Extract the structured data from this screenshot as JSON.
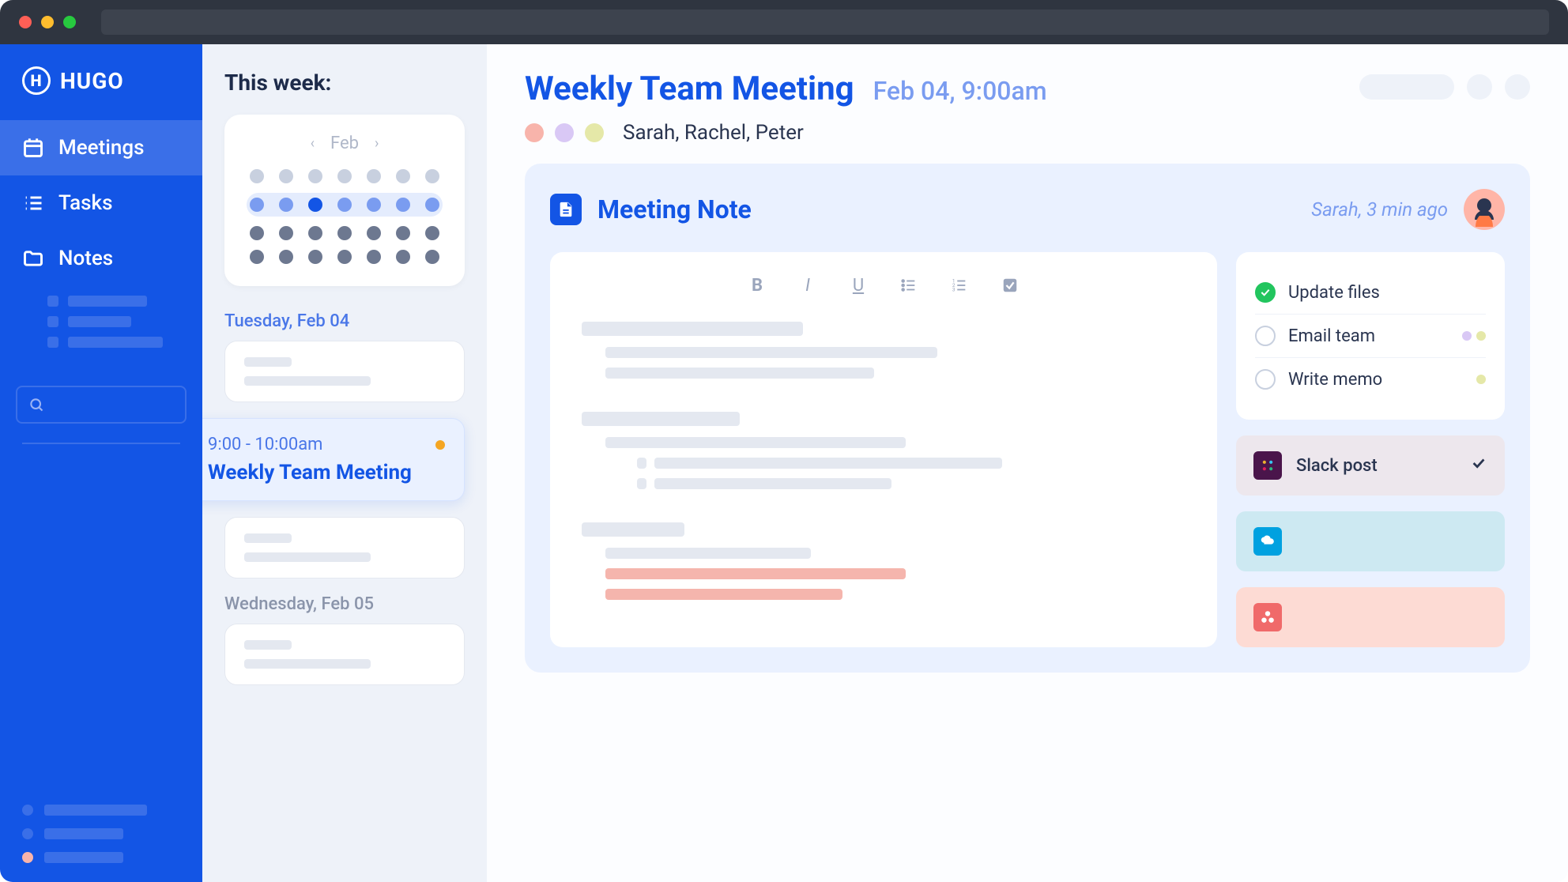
{
  "brand": "HUGO",
  "sidebar": {
    "items": [
      {
        "label": "Meetings"
      },
      {
        "label": "Tasks"
      },
      {
        "label": "Notes"
      }
    ]
  },
  "schedule": {
    "title": "This week:",
    "month": "Feb",
    "days": [
      {
        "label": "Tuesday, Feb 04"
      },
      {
        "label": "Wednesday, Feb 05"
      }
    ],
    "selected_event": {
      "time": "9:00 - 10:00am",
      "title": "Weekly Team Meeting"
    }
  },
  "meeting": {
    "title": "Weekly Team Meeting",
    "date": "Feb 04, 9:00am",
    "attendees": "Sarah, Rachel, Peter",
    "attendee_colors": [
      "#f8b4ab",
      "#d9c8f5",
      "#e5e8a8"
    ]
  },
  "note": {
    "title": "Meeting Note",
    "meta": "Sarah, 3 min ago"
  },
  "tasks": [
    {
      "label": "Update files",
      "done": true,
      "dots": []
    },
    {
      "label": "Email team",
      "done": false,
      "dots": [
        "#d9c8f5",
        "#e5e8a8"
      ]
    },
    {
      "label": "Write memo",
      "done": false,
      "dots": [
        "#e5e8a8"
      ]
    }
  ],
  "integrations": {
    "slack": "Slack post"
  }
}
